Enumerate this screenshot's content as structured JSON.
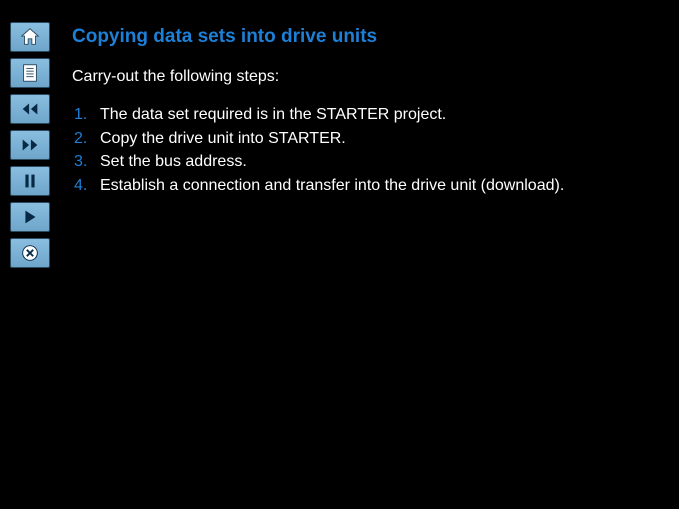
{
  "title": "Copying data sets into drive units",
  "intro": "Carry-out the following steps:",
  "steps": [
    {
      "num": "1.",
      "text": "The data set required is in the STARTER project."
    },
    {
      "num": "2.",
      "text": "Copy the drive unit into STARTER."
    },
    {
      "num": "3.",
      "text": "Set the bus address."
    },
    {
      "num": "4.",
      "text": "Establish a connection and transfer into the drive unit (download)."
    }
  ],
  "icons": {
    "home": "home-icon",
    "notes": "notes-icon",
    "rewind": "rewind-icon",
    "forward": "forward-icon",
    "pause": "pause-icon",
    "play": "play-icon",
    "close": "close-icon"
  }
}
